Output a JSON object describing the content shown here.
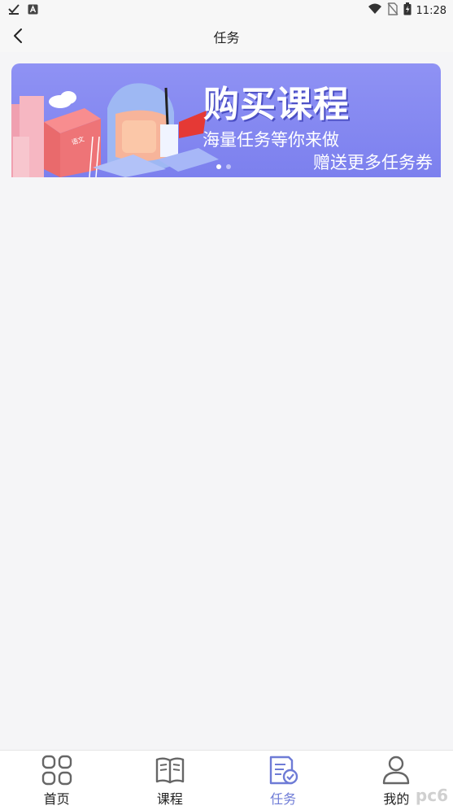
{
  "status_bar": {
    "time": "11:28",
    "left_icons": [
      "check-download-icon",
      "a-notification-icon"
    ],
    "right_icons": [
      "wifi-icon",
      "no-sim-icon",
      "battery-charging-icon"
    ]
  },
  "header": {
    "title": "任务"
  },
  "banner": {
    "title": "购买课程",
    "line1": "海量任务等你来做",
    "line2": "赠送更多任务券",
    "book_label": "语文",
    "slide_count": 2,
    "active_slide": 0
  },
  "tabs": [
    {
      "label": "首页",
      "icon": "home-grid-icon",
      "active": false
    },
    {
      "label": "课程",
      "icon": "book-icon",
      "active": false
    },
    {
      "label": "任务",
      "icon": "task-list-icon",
      "active": true
    },
    {
      "label": "我的",
      "icon": "profile-icon",
      "active": false
    }
  ],
  "watermark": "pc6",
  "colors": {
    "accent": "#6e7bd6",
    "banner_bg": "#8f92f4",
    "page_bg": "#f5f5f7"
  }
}
